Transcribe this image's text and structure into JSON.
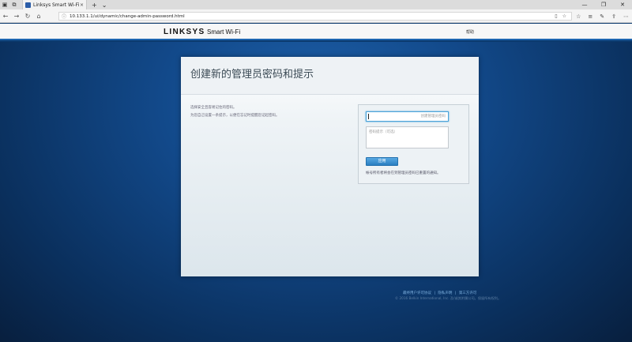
{
  "browser": {
    "tab_title": "Linksys Smart Wi-Fi",
    "tab_close": "×",
    "new_tab": "+",
    "tab_menu": "⌄",
    "url": "10.133.1.1/ui/dynamic/change-admin-password.html",
    "window_controls": [
      "—",
      "❐",
      "✕"
    ]
  },
  "header": {
    "brand": "LINKSYS",
    "product": "Smart Wi-Fi",
    "help": "帮助"
  },
  "panel": {
    "title": "创建新的管理员密码和提示",
    "desc_line1": "选择安全且容易记住的密码。",
    "desc_line2": "为您自己设置一条提示，以便在忘记时提醒您记起密码。",
    "password_placeholder": "创建管理员密码",
    "hint_placeholder": "密码提示（可选）",
    "save_button": "应用",
    "note": "帐号所有者将会在到管理员密码已重置的通知。"
  },
  "footer": {
    "link1": "最终用户许可协议",
    "link2": "隐私声明",
    "link3": "第三方许可",
    "sep": "|",
    "copyright": "© 2016 Belkin International, Inc. 及/或其附属公司。保留所有权利。"
  }
}
